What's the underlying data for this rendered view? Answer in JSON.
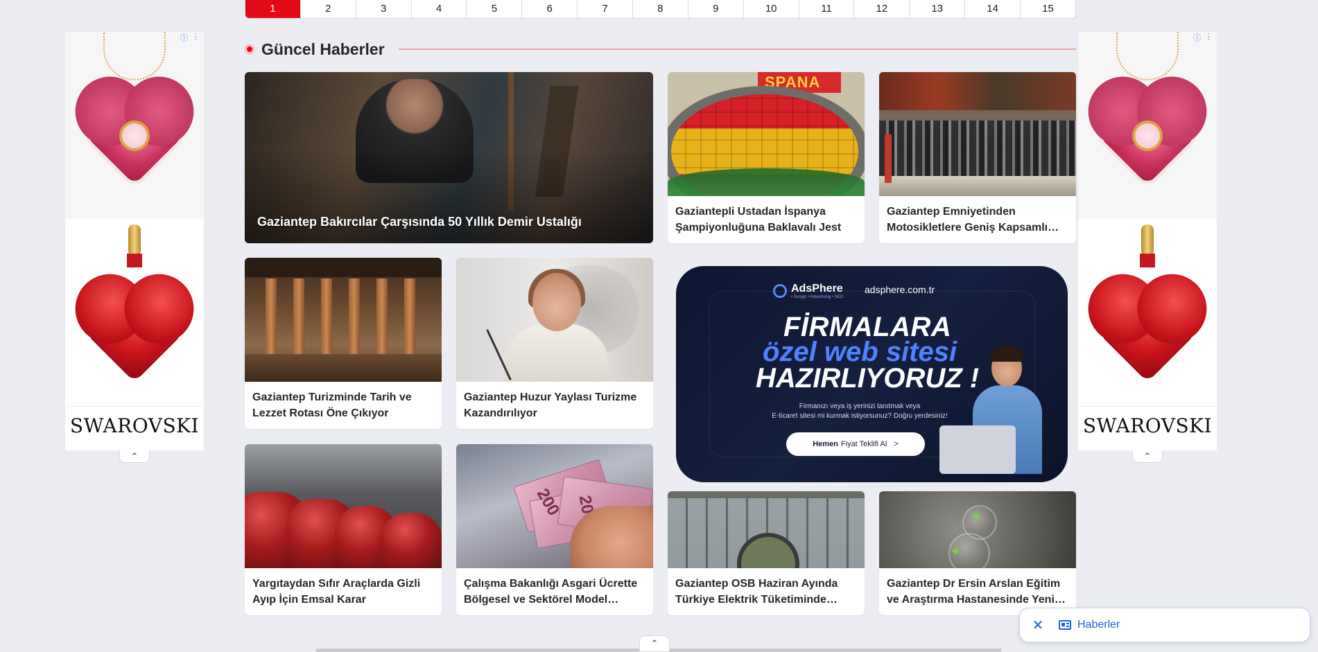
{
  "pagination": {
    "pages": [
      "1",
      "2",
      "3",
      "4",
      "5",
      "6",
      "7",
      "8",
      "9",
      "10",
      "11",
      "12",
      "13",
      "14",
      "15"
    ],
    "active": "1"
  },
  "section": {
    "title": "Güncel Haberler"
  },
  "featured": {
    "caption": "Gaziantep Bakırcılar Çarşısında 50 Yıllık Demir Ustalığı"
  },
  "news": {
    "baklava": "Gaziantepli Ustadan İspanya Şampiyonluğuna Baklavalı Jest",
    "motosiklet": "Gaziantep Emniyetinden Motosikletlere Geniş Kapsamlı Denetim",
    "turizm": "Gaziantep Turizminde Tarih ve Lezzet Rotası Öne Çıkıyor",
    "huzur": "Gaziantep Huzur Yaylası Turizme Kazandırılıyor",
    "yargitay": "Yargıtaydan Sıfır Araçlarda Gizli Ayıp İçin Emsal Karar",
    "asgari": "Çalışma Bakanlığı Asgari Ücrette Bölgesel ve Sektörel Model Çalışması",
    "osb": "Gaziantep OSB Haziran Ayında Türkiye Elektrik Tüketiminde Zirvede",
    "hastane": "Gaziantep Dr Ersin Arslan Eğitim ve Araştırma Hastanesinde Yeni Uygulama"
  },
  "photo_text": {
    "shirt": "SPANA",
    "banknote": "200"
  },
  "ad": {
    "brand": "AdsPhere",
    "brand_tagline": "• Design • Advertising • SEO",
    "site": "adsphere.com.tr",
    "headline_1": "FİRMALARA",
    "headline_2": "özel web sitesi",
    "headline_3": "HAZIRLIYORUZ !",
    "subtext_1": "Firmanızı veya iş yerinizi tanıtmak veya",
    "subtext_2": "E-ticaret sitesi mi kurmak istiyorsunuz? Doğru yerdesiniz!",
    "cta_bold": "Hemen",
    "cta_rest": "Fiyat Teklifi Al",
    "cta_arrow": ">"
  },
  "side_ads": {
    "brand": "SWAROVSKI",
    "info_icon": "ⓘ",
    "menu_icon": "⋮",
    "collapse_icon": "⌃"
  },
  "toast": {
    "close": "✕",
    "tab_label": "Haberler"
  },
  "colors": {
    "accent": "#e30a17",
    "link": "#1a63e0",
    "background": "#ecedf2"
  }
}
